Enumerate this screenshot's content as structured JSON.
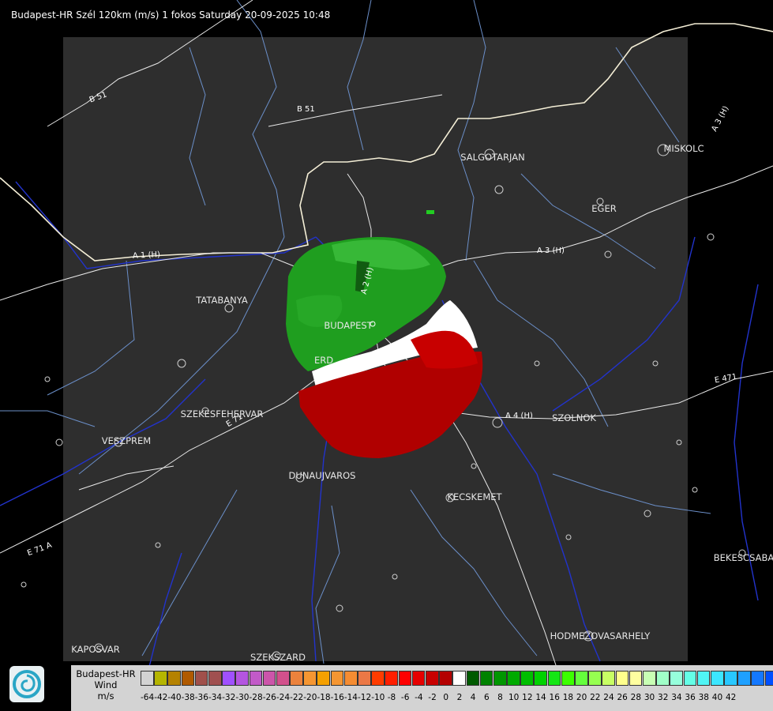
{
  "header": {
    "title": "Budapest-HR Szél 120km (m/s) 1 fokos Saturday 20-09-2025 10:48"
  },
  "cities": [
    {
      "name": "SALGOTARJAN"
    },
    {
      "name": "MISKOLC"
    },
    {
      "name": "EGER"
    },
    {
      "name": "TATABANYA"
    },
    {
      "name": "BUDAPEST"
    },
    {
      "name": "ERD"
    },
    {
      "name": "SZEKESFEHERVAR"
    },
    {
      "name": "VESZPREM"
    },
    {
      "name": "DUNAUJVAROS"
    },
    {
      "name": "KECSKEMET"
    },
    {
      "name": "SZOLNOK"
    },
    {
      "name": "BEKESCSABA"
    },
    {
      "name": "HODMEZOVASARHELY"
    },
    {
      "name": "KAPOSVAR"
    },
    {
      "name": "SZEKSZARD"
    }
  ],
  "roads": [
    {
      "label": "B 51"
    },
    {
      "label": "B 51"
    },
    {
      "label": "A 3 (H)"
    },
    {
      "label": "A 3 (H)"
    },
    {
      "label": "A 1 (H)"
    },
    {
      "label": "A 2 (H)"
    },
    {
      "label": "A 4 (H)"
    },
    {
      "label": "E 471"
    },
    {
      "label": "E 71"
    },
    {
      "label": "E 71 A"
    }
  ],
  "legend": {
    "title": [
      "Budapest-HR",
      "Wind",
      "m/s"
    ],
    "colors": [
      "#d3d3d3",
      "#b5b500",
      "#b58200",
      "#b05a00",
      "#a0504b",
      "#a05050",
      "#a050ff",
      "#b455e0",
      "#c25ac8",
      "#cc55aa",
      "#d2508c",
      "#eb823c",
      "#f59632",
      "#f5a000",
      "#f59632",
      "#f58c32",
      "#eb7846",
      "#ff3c00",
      "#ff1e00",
      "#ff0000",
      "#e60000",
      "#c80000",
      "#b40000",
      "#ffffff",
      "#005a00",
      "#008200",
      "#009600",
      "#00aa00",
      "#00be00",
      "#00d200",
      "#14e614",
      "#3cff00",
      "#64ff3c",
      "#96ff50",
      "#c8ff64",
      "#ffff8c",
      "#ffffa0",
      "#c8ffb4",
      "#a0ffc8",
      "#96ffdc",
      "#64ffe6",
      "#50f5f5",
      "#3ce6ff",
      "#28c8ff",
      "#1ea0ff",
      "#1478ff",
      "#0050ff",
      "#0000ff"
    ],
    "ticks": [
      "-64",
      "-42",
      "-40",
      "-38",
      "-36",
      "-34",
      "-32",
      "-30",
      "-28",
      "-26",
      "-24",
      "-22",
      "-20",
      "-18",
      "-16",
      "-14",
      "-12",
      "-10",
      "-8",
      "-6",
      "-4",
      "-2",
      "0",
      "2",
      "4",
      "6",
      "8",
      "10",
      "12",
      "14",
      "16",
      "18",
      "20",
      "22",
      "24",
      "26",
      "28",
      "30",
      "32",
      "34",
      "36",
      "38",
      "40",
      "42"
    ]
  }
}
